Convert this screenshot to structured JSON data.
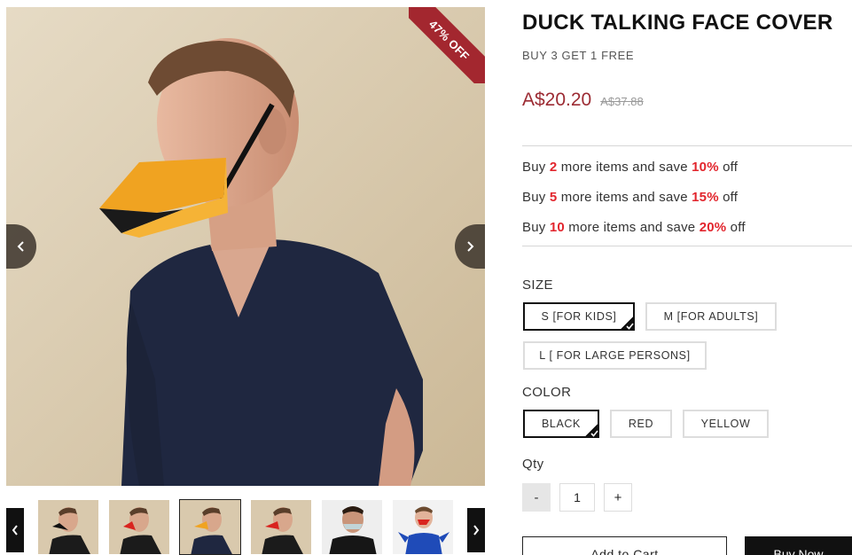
{
  "product": {
    "title": "DUCK TALKING FACE COVER",
    "promo": "BUY 3 GET 1 FREE",
    "price_now": "A$20.20",
    "price_was": "A$37.88",
    "discount_badge": "47% OFF"
  },
  "deals": [
    {
      "pre": "Buy ",
      "count": "2",
      "mid": " more items and save ",
      "pct": "10%",
      "post": " off"
    },
    {
      "pre": "Buy ",
      "count": "5",
      "mid": " more items and save ",
      "pct": "15%",
      "post": " off"
    },
    {
      "pre": "Buy ",
      "count": "10",
      "mid": " more items and save ",
      "pct": "20%",
      "post": " off"
    }
  ],
  "size": {
    "label": "SIZE",
    "options": [
      "S [FOR KIDS]",
      "M [FOR ADULTS]",
      "L [ FOR LARGE PERSONS]"
    ],
    "selected": "S [FOR KIDS]"
  },
  "color": {
    "label": "COLOR",
    "options": [
      "BLACK",
      "RED",
      "YELLOW"
    ],
    "selected": "BLACK"
  },
  "quantity": {
    "label": "Qty",
    "minus": "-",
    "value": "1",
    "plus": "+"
  },
  "actions": {
    "add_to_cart": "Add to Cart",
    "buy_now": "Buy Now"
  },
  "gallery": {
    "thumbnails": [
      "black mask",
      "red mask",
      "yellow mask",
      "red mask side",
      "clear mask",
      "child red mask"
    ],
    "active_thumbnail": 2
  },
  "colors": {
    "accent_price": "#9c2b33",
    "badge": "#a3272f",
    "deal_highlight": "#e2252d"
  }
}
